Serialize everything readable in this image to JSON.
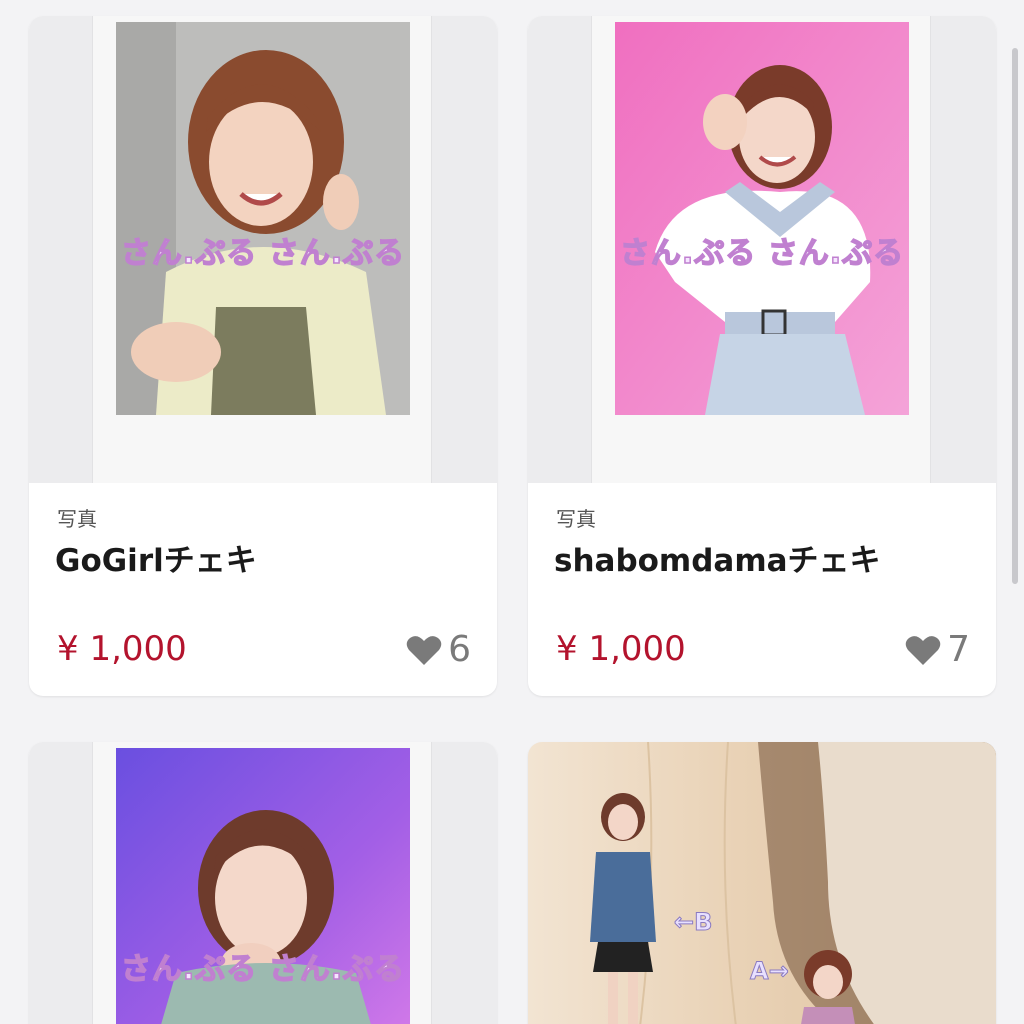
{
  "products": [
    {
      "category": "写真",
      "title": "GoGirlチェキ",
      "price": "¥ 1,000",
      "likes": "6",
      "watermark": "さん.ぷる さん.ぷる"
    },
    {
      "category": "写真",
      "title": "shabomdamaチェキ",
      "price": "¥ 1,000",
      "likes": "7",
      "watermark": "さん.ぷる さん.ぷる"
    },
    {
      "watermark": "さん.ぷる さん.ぷる"
    },
    {
      "labels": [
        "←B",
        "A→"
      ]
    }
  ],
  "colors": {
    "price": "#b3132d",
    "like_icon": "#7a7a7a",
    "watermark_stroke": "#c080d0"
  },
  "icons": {
    "like": "heart-icon"
  }
}
